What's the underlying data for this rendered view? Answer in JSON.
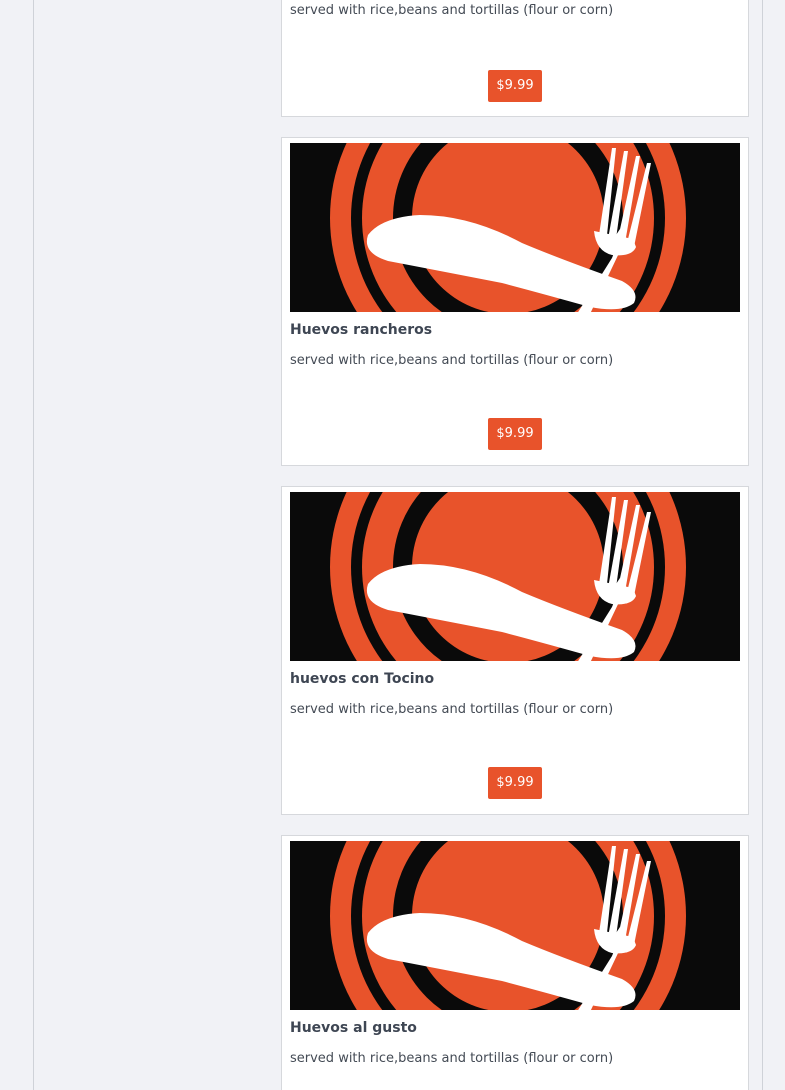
{
  "menu": {
    "items": [
      {
        "title": "",
        "description": "served with rice,beans and tortillas (flour or corn)",
        "price": "$9.99"
      },
      {
        "title": "Huevos rancheros",
        "description": "served with rice,beans and tortillas (flour or corn)",
        "price": "$9.99",
        "image_icon": "plate-fork-knife-icon"
      },
      {
        "title": "huevos con Tocino",
        "description": "served with rice,beans and tortillas (flour or corn)",
        "price": "$9.99",
        "image_icon": "plate-fork-knife-icon"
      },
      {
        "title": "Huevos al gusto",
        "description": "served with rice,beans and tortillas (flour or corn)",
        "image_icon": "plate-fork-knife-icon"
      }
    ]
  },
  "colors": {
    "accent": "#e8532b",
    "image_bg": "#0a0a0a",
    "page_bg": "#f1f2f6"
  }
}
